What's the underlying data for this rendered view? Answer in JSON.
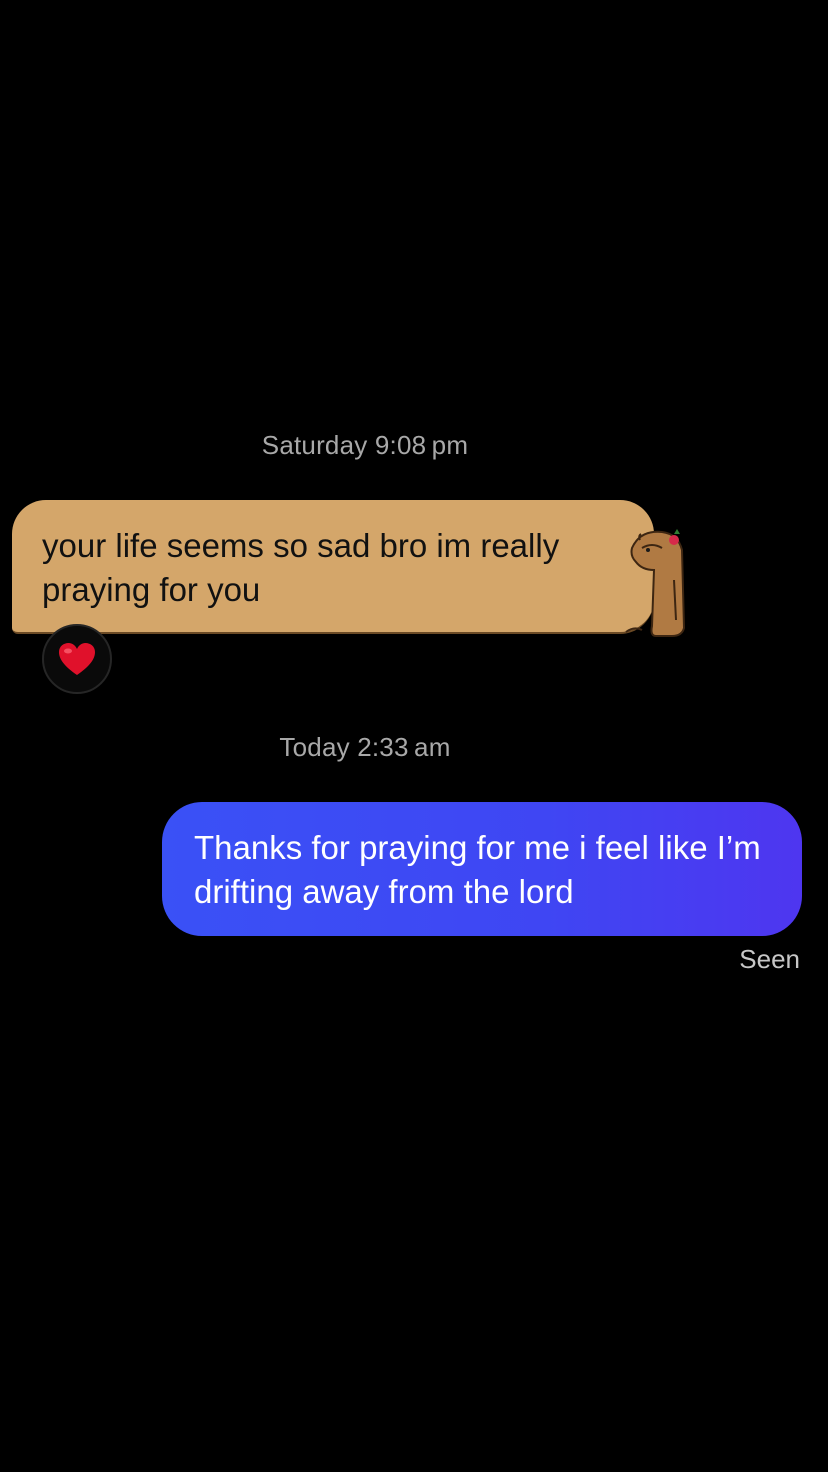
{
  "conversation": {
    "timestamps": [
      "Saturday 9:08 pm",
      "Today 2:33 am"
    ],
    "incoming_message": {
      "text": "your life seems so sad bro im really praying for you",
      "reaction": "❤️",
      "bubble_color": "#d4a66a",
      "sticker": "capybara-icon"
    },
    "outgoing_message": {
      "text": "Thanks for praying for me i feel like I’m drifting away from the lord",
      "bubble_color": "#3f46f3"
    },
    "status": "Seen"
  }
}
